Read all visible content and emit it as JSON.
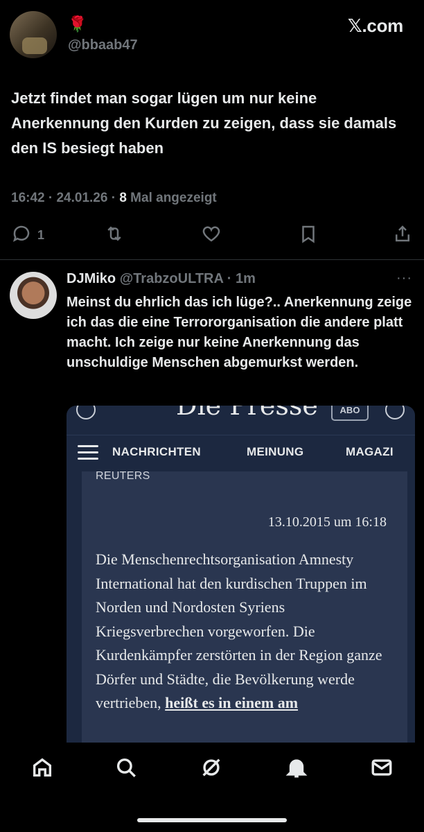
{
  "brand": "𝕏.com",
  "tweet": {
    "emoji": "🌹",
    "handle": "@bbaab47",
    "text": "Jetzt findet man sogar lügen um nur keine Anerkennung den Kurden zu zeigen, dass sie damals den IS besiegt haben",
    "time": "16:42 · 24.01.26 · ",
    "views_count": "8",
    "views_label": " Mal angezeigt",
    "reply_count": "1"
  },
  "reply": {
    "name": "DJMiko",
    "handle": "@TrabzoULTRA · 1m",
    "more": "···",
    "text": "Meinst du ehrlich das ich lüge?.. Anerkennung zeige ich das die eine Terrororganisation die andere platt macht. Ich zeige nur keine Anerkennung das unschuldige Menschen abgemurkst werden."
  },
  "embed": {
    "brand": "Die Presse",
    "abo": "ABO",
    "nav": [
      "NACHRICHTEN",
      "MEINUNG",
      "MAGAZI"
    ],
    "source": "REUTERS",
    "date": "13.10.2015 um 16:18",
    "body": "Die Menschenrechtsorganisation Amnesty International hat den kurdischen Truppen im Norden und Nordosten Syriens Kriegsverbrechen vorgeworfen. Die Kurdenkämpfer zerstörten in der Region ganze Dörfer und Städte, die Bevölkerung werde vertrieben, ",
    "body_link": "heißt es in einem am"
  },
  "icons": [
    "home-icon",
    "search-icon",
    "grok-icon",
    "notifications-icon",
    "messages-icon",
    "reply-icon",
    "repost-icon",
    "like-icon",
    "bookmark-icon",
    "share-icon"
  ]
}
